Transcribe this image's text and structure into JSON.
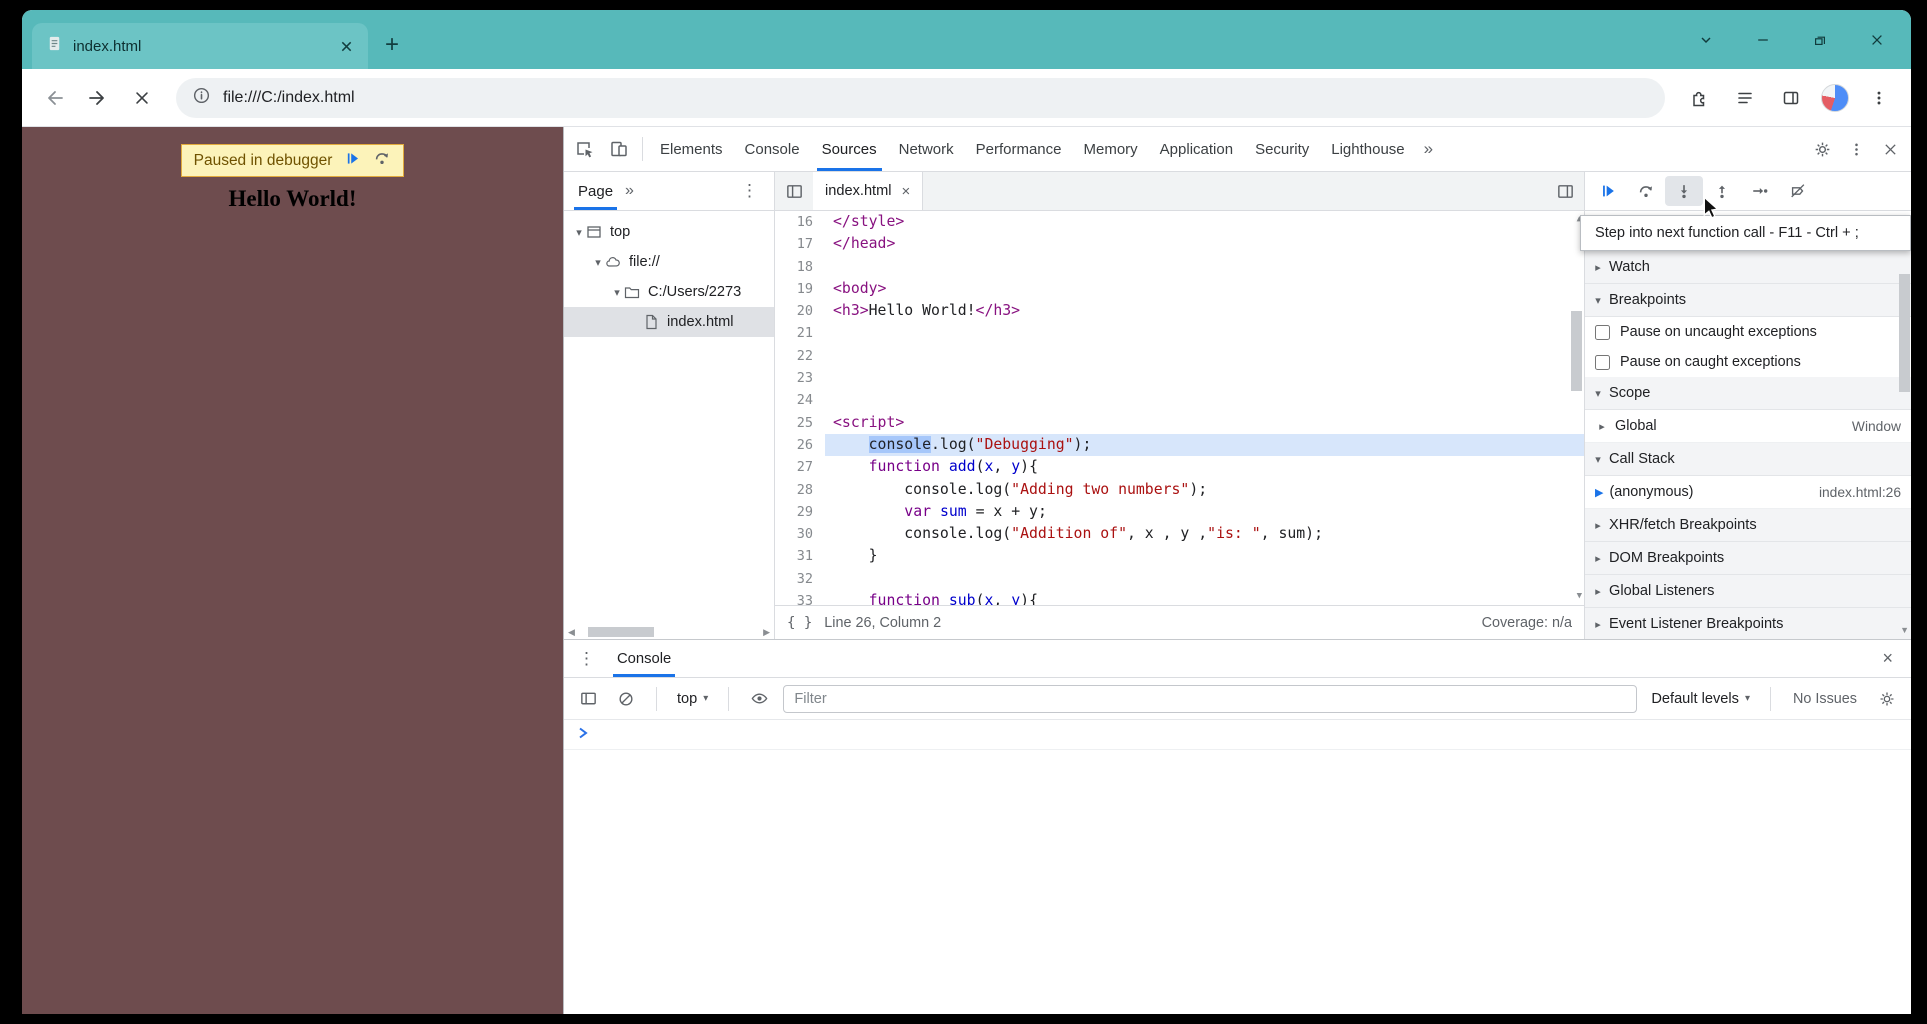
{
  "colors": {
    "frame": "#57b9ba",
    "tab": "#6cc4c5",
    "accent": "#1a73e8",
    "page-bg": "#6e4c4e",
    "banner-bg": "#fcf3ba",
    "banner-border": "#e1aa3c",
    "banner-text": "#6f5200",
    "paused-line": "#d7e6fb",
    "word-selection": "#a6c7fa"
  },
  "browser": {
    "tab_title": "index.html",
    "url": "file:///C:/index.html"
  },
  "page": {
    "paused_banner": "Paused in debugger",
    "heading": "Hello World!"
  },
  "devtools": {
    "tabs": [
      "Elements",
      "Console",
      "Sources",
      "Network",
      "Performance",
      "Memory",
      "Application",
      "Security",
      "Lighthouse"
    ],
    "active_tab": "Sources",
    "more_tabs": "»",
    "sources": {
      "nav_tab": "Page",
      "tree": [
        {
          "label": "top",
          "icon": "frame",
          "depth": 0,
          "expanded": true
        },
        {
          "label": "file://",
          "icon": "cloud",
          "depth": 1,
          "expanded": true
        },
        {
          "label": "C:/Users/2273",
          "icon": "folder",
          "depth": 2,
          "expanded": true
        },
        {
          "label": "index.html",
          "icon": "file",
          "depth": 3,
          "selected": true
        }
      ],
      "file_tab": "index.html",
      "code": [
        {
          "n": 16,
          "t": [
            [
              "tag",
              "</style>"
            ]
          ]
        },
        {
          "n": 17,
          "t": [
            [
              "tag",
              "</head>"
            ]
          ]
        },
        {
          "n": 18,
          "t": []
        },
        {
          "n": 19,
          "t": [
            [
              "tag",
              "<body>"
            ]
          ]
        },
        {
          "n": 20,
          "t": [
            [
              "tag",
              "<h3>"
            ],
            [
              "pl",
              "Hello World!"
            ],
            [
              "tag",
              "</h3>"
            ]
          ]
        },
        {
          "n": 21,
          "t": []
        },
        {
          "n": 22,
          "t": []
        },
        {
          "n": 23,
          "t": []
        },
        {
          "n": 24,
          "t": []
        },
        {
          "n": 25,
          "t": [
            [
              "tag",
              "<script>"
            ]
          ]
        },
        {
          "n": 26,
          "paused": true,
          "t": [
            [
              "pl",
              "    "
            ],
            [
              "sel",
              "console"
            ],
            [
              "pl",
              ".log("
            ],
            [
              "str",
              "\"Debugging\""
            ],
            [
              "pl",
              ");"
            ]
          ]
        },
        {
          "n": 27,
          "t": [
            [
              "pl",
              "    "
            ],
            [
              "kw",
              "function"
            ],
            [
              "pl",
              " "
            ],
            [
              "def",
              "add"
            ],
            [
              "pl",
              "("
            ],
            [
              "def",
              "x"
            ],
            [
              "pl",
              ", "
            ],
            [
              "def",
              "y"
            ],
            [
              "pl",
              "){"
            ]
          ]
        },
        {
          "n": 28,
          "t": [
            [
              "pl",
              "        console.log("
            ],
            [
              "str",
              "\"Adding two numbers\""
            ],
            [
              "pl",
              ");"
            ]
          ]
        },
        {
          "n": 29,
          "t": [
            [
              "pl",
              "        "
            ],
            [
              "kw",
              "var"
            ],
            [
              "pl",
              " "
            ],
            [
              "def",
              "sum"
            ],
            [
              "pl",
              " = x + y;"
            ]
          ]
        },
        {
          "n": 30,
          "t": [
            [
              "pl",
              "        console.log("
            ],
            [
              "str",
              "\"Addition of\""
            ],
            [
              "pl",
              ", x , y ,"
            ],
            [
              "str",
              "\"is: \""
            ],
            [
              "pl",
              ", sum);"
            ]
          ]
        },
        {
          "n": 31,
          "t": [
            [
              "pl",
              "    }"
            ]
          ]
        },
        {
          "n": 32,
          "t": []
        },
        {
          "n": 33,
          "t": [
            [
              "pl",
              "    "
            ],
            [
              "kw",
              "function"
            ],
            [
              "pl",
              " "
            ],
            [
              "def",
              "sub"
            ],
            [
              "pl",
              "("
            ],
            [
              "def",
              "x"
            ],
            [
              "pl",
              ", "
            ],
            [
              "def",
              "y"
            ],
            [
              "pl",
              "){"
            ]
          ]
        }
      ],
      "status_position": "Line 26, Column 2",
      "status_coverage": "Coverage: n/a"
    },
    "debugger": {
      "tooltip": "Step into next function call - F11 - Ctrl + ;",
      "sections": [
        {
          "label": "Watch",
          "expanded": false
        },
        {
          "label": "Breakpoints",
          "expanded": true,
          "items": [
            {
              "type": "checkbox",
              "label": "Pause on uncaught exceptions",
              "checked": false
            },
            {
              "type": "checkbox",
              "label": "Pause on caught exceptions",
              "checked": false
            }
          ]
        },
        {
          "label": "Scope",
          "expanded": true,
          "items": [
            {
              "type": "tree",
              "label": "Global",
              "right": "Window"
            }
          ]
        },
        {
          "label": "Call Stack",
          "expanded": true,
          "items": [
            {
              "type": "stack",
              "label": "(anonymous)",
              "right": "index.html:26",
              "active": true
            }
          ]
        },
        {
          "label": "XHR/fetch Breakpoints",
          "expanded": false
        },
        {
          "label": "DOM Breakpoints",
          "expanded": false
        },
        {
          "label": "Global Listeners",
          "expanded": false
        },
        {
          "label": "Event Listener Breakpoints",
          "expanded": false
        }
      ]
    }
  },
  "console": {
    "tab": "Console",
    "context": "top",
    "filter_placeholder": "Filter",
    "levels": "Default levels",
    "issues": "No Issues"
  }
}
